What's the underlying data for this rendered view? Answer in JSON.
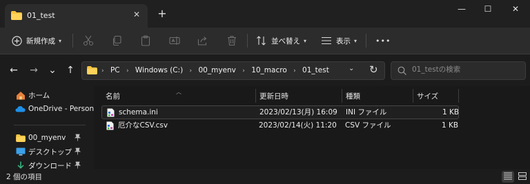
{
  "window": {
    "tab_title": "01_test",
    "tab_close": "✕",
    "new_tab": "+",
    "minimize": "—",
    "maximize": "☐",
    "close": "✕"
  },
  "toolbar": {
    "new_label": "新規作成",
    "sort_label": "並べ替え",
    "view_label": "表示",
    "more": "•••"
  },
  "nav": {
    "back": "←",
    "forward": "→",
    "recent": "⌄",
    "up": "↑",
    "breadcrumbs": [
      "PC",
      "Windows (C:)",
      "00_myenv",
      "10_macro",
      "01_test"
    ],
    "crumb_sep": "›",
    "search_placeholder": "01_testの検索"
  },
  "sidebar": {
    "items": [
      {
        "label": "ホーム",
        "icon": "home-icon"
      },
      {
        "label": "OneDrive - Person",
        "icon": "onedrive-icon"
      },
      {
        "label": "00_myenv",
        "icon": "folder-icon",
        "pinned": true
      },
      {
        "label": "デスクトップ",
        "icon": "desktop-icon",
        "pinned": true
      },
      {
        "label": "ダウンロード",
        "icon": "download-icon",
        "pinned": true
      }
    ],
    "pin_glyph": "📌"
  },
  "file_list": {
    "columns": [
      "名前",
      "更新日時",
      "種類",
      "サイズ"
    ],
    "rows": [
      {
        "name": "schema.ini",
        "modified": "2023/02/13(月) 16:09",
        "type": "INI ファイル",
        "size": "1 KB",
        "selected": true
      },
      {
        "name": "厄介なCSV.csv",
        "modified": "2023/02/14(火) 11:20",
        "type": "CSV ファイル",
        "size": "1 KB",
        "selected": false
      }
    ]
  },
  "status": {
    "item_count": "2 個の項目"
  },
  "colors": {
    "folder_yellow": "#f6c342",
    "accent": "#4cc2ff",
    "background": "#1c1c1c"
  }
}
